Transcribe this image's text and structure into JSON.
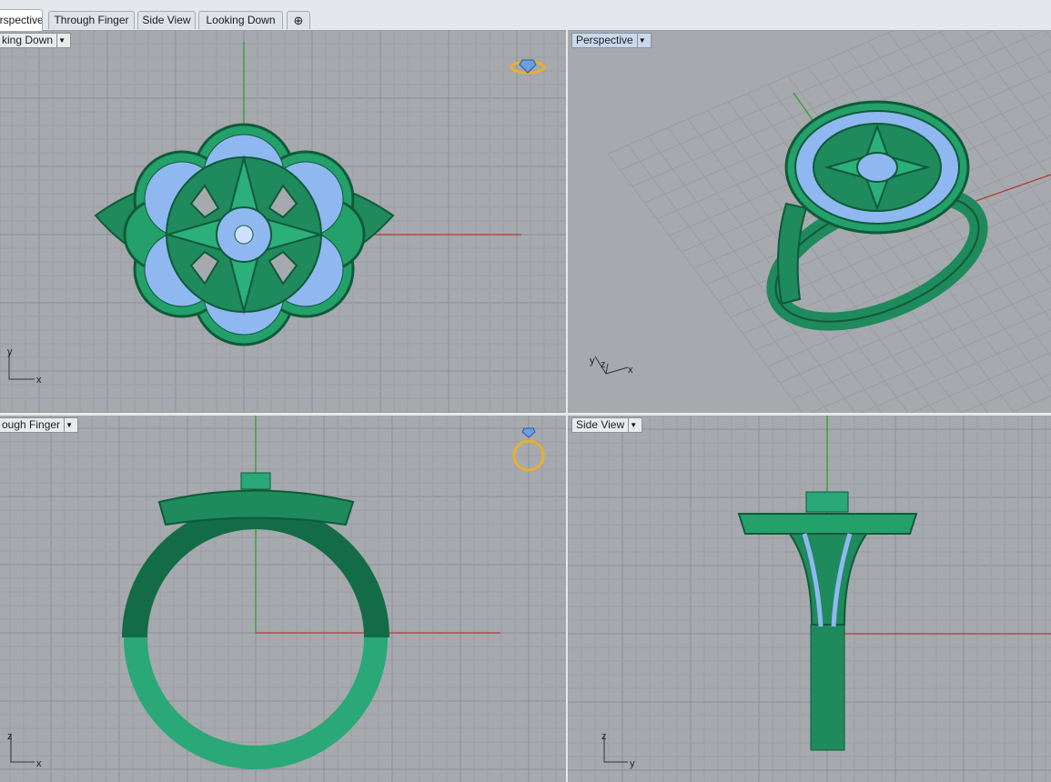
{
  "tabs": [
    {
      "label": "Perspective",
      "active": true
    },
    {
      "label": "Through Finger",
      "active": false
    },
    {
      "label": "Side View",
      "active": false
    },
    {
      "label": "Looking Down",
      "active": false
    }
  ],
  "add_tab_icon": "plus-icon",
  "viewports": {
    "top_left": {
      "label": "king Down",
      "axes": [
        "y",
        "x"
      ]
    },
    "top_right": {
      "label": "Perspective",
      "axes": [
        "y",
        "z",
        "x"
      ]
    },
    "bottom_left": {
      "label": "ough Finger",
      "axes": [
        "z",
        "x"
      ]
    },
    "bottom_right": {
      "label": "Side View",
      "axes": [
        "z",
        "y"
      ]
    }
  },
  "colors": {
    "viewport_bg": "#a6a9ad",
    "grid_minor": "#9b9ea3",
    "grid_major": "#8c9096",
    "metal": "#1f8a5c",
    "metal_dark": "#0f5a3a",
    "gem": "#8fb8f0",
    "axis_x": "#b23a3a",
    "axis_y": "#2fa02f",
    "gizmo": "#e8b030"
  }
}
